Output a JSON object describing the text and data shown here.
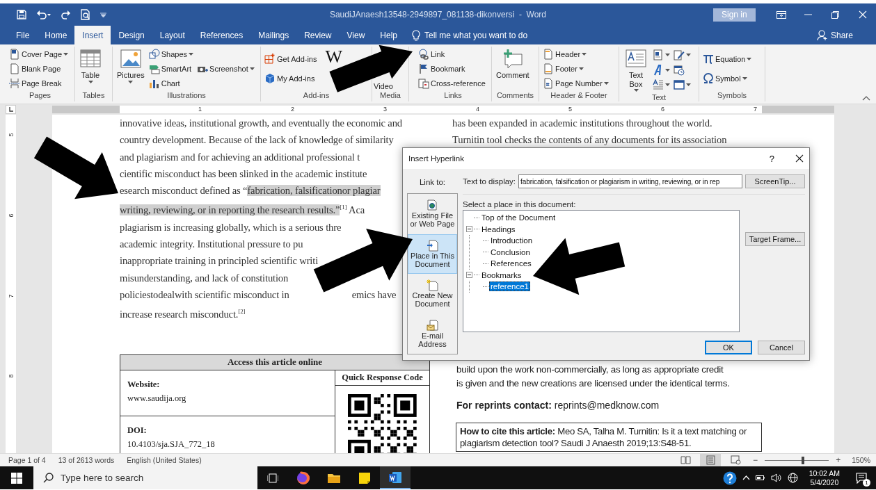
{
  "window": {
    "title": "SaudiJAnaesh13548-2949897_081138-dikonversi  -  Word",
    "sign_in": "Sign in"
  },
  "tabs": [
    {
      "label": "File",
      "selected": false
    },
    {
      "label": "Home",
      "selected": false
    },
    {
      "label": "Insert",
      "selected": true
    },
    {
      "label": "Design",
      "selected": false
    },
    {
      "label": "Layout",
      "selected": false
    },
    {
      "label": "References",
      "selected": false
    },
    {
      "label": "Mailings",
      "selected": false
    },
    {
      "label": "Review",
      "selected": false
    },
    {
      "label": "View",
      "selected": false
    },
    {
      "label": "Help",
      "selected": false
    }
  ],
  "tell_me": "Tell me what you want to do",
  "share": "Share",
  "ribbon": {
    "groups": [
      {
        "label": "Pages",
        "items": [
          {
            "kind": "small",
            "label": "Cover Page",
            "dropdown": true
          },
          {
            "kind": "small",
            "label": "Blank Page",
            "dropdown": false
          },
          {
            "kind": "small",
            "label": "Page Break",
            "dropdown": false
          }
        ]
      },
      {
        "label": "Tables",
        "items": [
          {
            "kind": "large",
            "label": "Table",
            "dropdown": true
          }
        ]
      },
      {
        "label": "Illustrations",
        "items": [
          {
            "kind": "large",
            "label": "Pictures",
            "dropdown": true
          },
          {
            "kind": "small",
            "label": "Shapes",
            "dropdown": true
          },
          {
            "kind": "small",
            "label": "SmartArt",
            "dropdown": false
          },
          {
            "kind": "small",
            "label": "Chart",
            "dropdown": false
          },
          {
            "kind": "small",
            "label": "Screenshot",
            "dropdown": true
          }
        ]
      },
      {
        "label": "Add-ins",
        "items": [
          {
            "kind": "small",
            "label": "Get Add-ins",
            "dropdown": false
          },
          {
            "kind": "small",
            "label": "My Add-ins",
            "dropdown": false
          },
          {
            "kind": "logo",
            "label": "W"
          }
        ]
      },
      {
        "label": "Media",
        "items": [
          {
            "kind": "large",
            "label": "Video",
            "dropdown": false
          }
        ]
      },
      {
        "label": "Links",
        "items": [
          {
            "kind": "small",
            "label": "Link",
            "dropdown": false
          },
          {
            "kind": "small",
            "label": "Bookmark",
            "dropdown": false
          },
          {
            "kind": "small",
            "label": "Cross-reference",
            "dropdown": false
          }
        ]
      },
      {
        "label": "Comments",
        "items": [
          {
            "kind": "large",
            "label": "Comment",
            "dropdown": false
          }
        ]
      },
      {
        "label": "Header & Footer",
        "items": [
          {
            "kind": "small",
            "label": "Header",
            "dropdown": true
          },
          {
            "kind": "small",
            "label": "Footer",
            "dropdown": true
          },
          {
            "kind": "small",
            "label": "Page Number",
            "dropdown": true
          }
        ]
      },
      {
        "label": "Text",
        "items": [
          {
            "kind": "large",
            "label": "Text Box",
            "dropdown": true
          },
          {
            "kind": "icon",
            "dropdown": true
          },
          {
            "kind": "icon",
            "dropdown": true
          },
          {
            "kind": "icon",
            "dropdown": true
          },
          {
            "kind": "icon",
            "dropdown": true
          },
          {
            "kind": "icon",
            "dropdown": false
          },
          {
            "kind": "icon",
            "dropdown": true
          }
        ]
      },
      {
        "label": "Symbols",
        "items": [
          {
            "kind": "small",
            "label": "Equation",
            "dropdown": true
          },
          {
            "kind": "small",
            "label": "Symbol",
            "dropdown": true
          }
        ]
      }
    ]
  },
  "ruler": {
    "marks": [
      "1",
      "2",
      "3",
      "4",
      "5",
      "6",
      "7"
    ]
  },
  "vertical_ruler": {
    "marks": [
      "5",
      "6",
      "7",
      "8"
    ]
  },
  "document": {
    "left_lines": [
      [
        {
          "text": "innovative ideas, institutional growth, and eventually the economic and",
          "highlighted": false
        }
      ],
      [
        {
          "text": "country development. Because of the lack of knowledge of similarity",
          "highlighted": false
        }
      ],
      [
        {
          "text": "and plagiarism and for achieving an additional professional t",
          "highlighted": false
        }
      ],
      [
        {
          "text": "cientific misconduct has been slinked in the academic institute",
          "highlighted": false
        }
      ],
      [
        {
          "text": "esearch misconduct defined as “",
          "highlighted": false
        },
        {
          "text": "fabrication, falsificationor plagiar",
          "highlighted": true
        }
      ],
      [
        {
          "text": "writing, reviewing, or in reporting the research  results.”",
          "highlighted": true
        },
        {
          "text": "$^{[1]}$ Aca",
          "highlighted": false
        }
      ],
      [
        {
          "text": "plagiarism is increasing globally, which is a serious thre",
          "highlighted": false
        }
      ],
      [
        {
          "text": "academic integrity. Institutional pressure to pu",
          "highlighted": false
        }
      ],
      [
        {
          "text": "inappropriate training in principled scientific writi",
          "highlighted": false
        }
      ],
      [
        {
          "text": "misunderstanding, and lack of constitution",
          "highlighted": false
        }
      ],
      [
        {
          "text": "policiestodealwith scientific misconduct in",
          "highlighted": false
        },
        {
          "text": "emics have",
          "highlighted": false,
          "covered_before": true
        }
      ],
      [
        {
          "text": "increase research misconduct.$^{[2]}$",
          "highlighted": false
        }
      ]
    ],
    "access_table": {
      "title": "Access this article online",
      "website_label": "Website:",
      "website": "www.saudija.org",
      "doi_label": "DOI:",
      "doi": "10.4103/sja.SJA_772_18",
      "qr_label": "Quick Response Code"
    },
    "right_top_lines": [
      "has been expanded in academic institutions throughout the world.",
      "Turnitin tool checks the contents of any documents for its association"
    ],
    "license_lines": [
      "build upon the work non-commercially, as long as appropriate credit",
      "is given and the new creations are licensed under the identical terms."
    ],
    "reprints": "**For reprints contact:** reprints@medknow.com",
    "citation": "**How to cite this article:**  Meo SA, Talha M. Turnitin: Is it a text matching or plagiarism detection tool? Saudi J Anaesth 2019;13:S48-51."
  },
  "dialog": {
    "title": "Insert Hyperlink",
    "help": "?",
    "link_to_label": "Link to:",
    "link_to": [
      {
        "label": "Existing File or Web Page",
        "selected": false
      },
      {
        "label": "Place in This Document",
        "selected": true
      },
      {
        "label": "Create New Document",
        "selected": false
      },
      {
        "label": "E-mail Address",
        "selected": false
      }
    ],
    "text_to_display": {
      "label": "Text to display:",
      "value": "fabrication, falsification or plagiarism in writing, reviewing, or in rep"
    },
    "screentip": "ScreenTip...",
    "place_label": "Select a place in this document:",
    "tree": [
      {
        "label": "Top of the Document",
        "selected": false
      },
      {
        "label": "Headings",
        "selected": false,
        "expanded": true,
        "children": [
          {
            "label": "Introduction",
            "selected": false
          },
          {
            "label": "Conclusion",
            "selected": false
          },
          {
            "label": "References",
            "selected": false
          }
        ]
      },
      {
        "label": "Bookmarks",
        "selected": false,
        "expanded": true,
        "children": [
          {
            "label": "reference1",
            "selected": true
          }
        ]
      }
    ],
    "target_frame": "Target Frame...",
    "ok": {
      "label": "OK",
      "default": true
    },
    "cancel": "Cancel"
  },
  "status_bar": {
    "page": "Page 1 of 4",
    "words": "13 of 2613 words",
    "language": "English (United States)",
    "views": [
      {
        "selected": false
      },
      {
        "selected": true
      },
      {
        "selected": false
      }
    ],
    "zoom_out": "−",
    "zoom": {
      "level": 0.6
    },
    "zoom_in": "+",
    "zoom_reading": "150%"
  },
  "taskbar": {
    "search": {
      "placeholder": "Type here to search"
    },
    "apps": [
      {
        "active": false
      },
      {
        "active": false
      },
      {
        "active": false
      },
      {
        "active": true
      }
    ],
    "time": "10:02 AM",
    "date": "5/4/2020",
    "notifications": "1"
  }
}
